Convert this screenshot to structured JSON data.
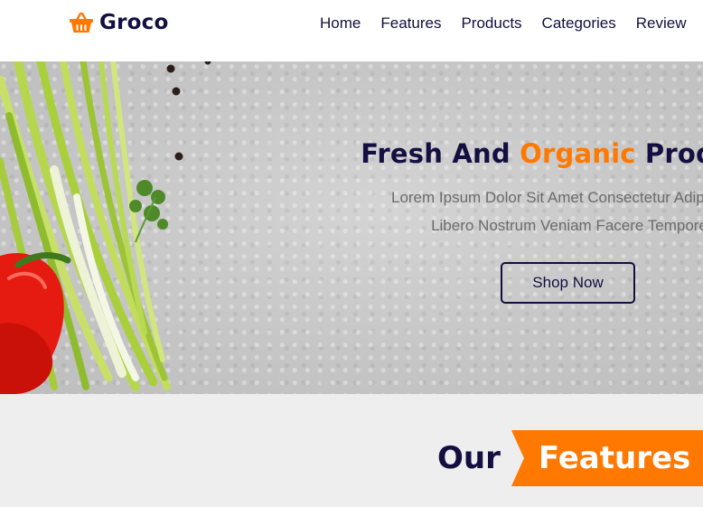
{
  "brand": {
    "name": "Groco",
    "icon": "shopping-basket-icon",
    "accent_color": "#ff7800",
    "text_color": "#130f40"
  },
  "nav": {
    "items": [
      {
        "label": "Home"
      },
      {
        "label": "Features"
      },
      {
        "label": "Products"
      },
      {
        "label": "Categories"
      },
      {
        "label": "Review"
      }
    ]
  },
  "hero": {
    "title_part1": "Fresh And ",
    "title_accent": "Organic",
    "title_part2": " Products",
    "text_line1": "Lorem Ipsum Dolor Sit Amet Consectetur Adipisicing",
    "text_line2": "Libero Nostrum Veniam Facere Tempore",
    "cta_label": "Shop Now"
  },
  "features": {
    "heading_word": "Our",
    "heading_ribbon": "Features"
  }
}
